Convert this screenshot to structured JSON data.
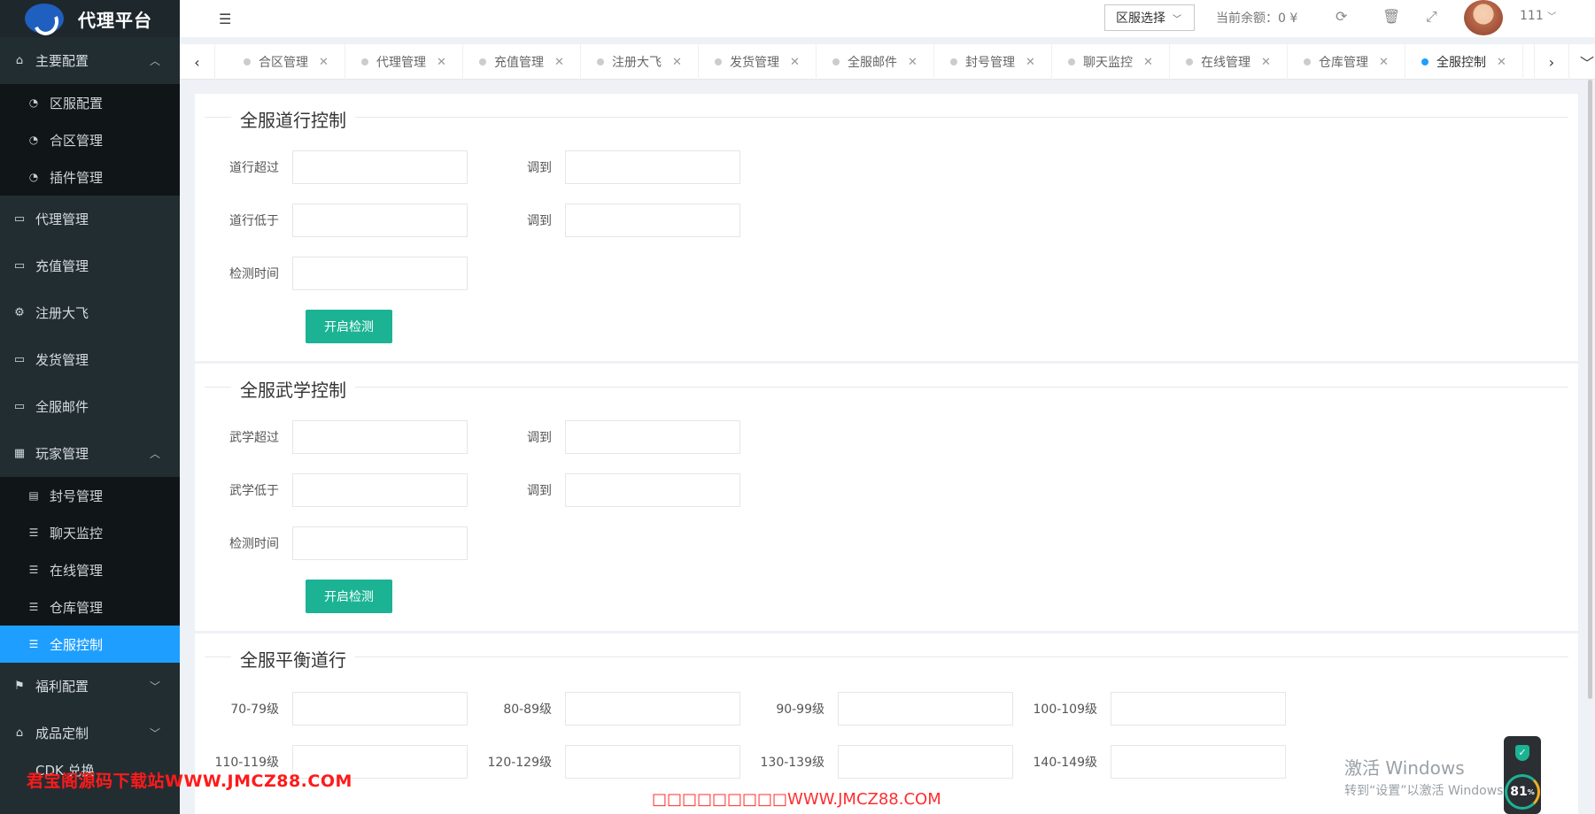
{
  "app": {
    "title": "代理平台"
  },
  "sidebar": {
    "groups": [
      {
        "label": "主要配置",
        "icon": "home-icon",
        "expanded": true,
        "items": [
          {
            "label": "区服配置",
            "icon": "dashboard-icon"
          },
          {
            "label": "合区管理",
            "icon": "dashboard-icon"
          },
          {
            "label": "插件管理",
            "icon": "dashboard-icon"
          }
        ]
      },
      {
        "label": "代理管理",
        "icon": "window-icon"
      },
      {
        "label": "充值管理",
        "icon": "window-icon"
      },
      {
        "label": "注册大飞",
        "icon": "gears-icon"
      },
      {
        "label": "发货管理",
        "icon": "window-icon"
      },
      {
        "label": "全服邮件",
        "icon": "window-icon"
      },
      {
        "label": "玩家管理",
        "icon": "calendar-icon",
        "expanded": true,
        "items": [
          {
            "label": "封号管理",
            "icon": "list-alt-icon"
          },
          {
            "label": "聊天监控",
            "icon": "list-icon"
          },
          {
            "label": "在线管理",
            "icon": "list-icon"
          },
          {
            "label": "仓库管理",
            "icon": "list-icon"
          },
          {
            "label": "全服控制",
            "icon": "list-icon",
            "active": true
          }
        ]
      },
      {
        "label": "福利配置",
        "icon": "flag-icon",
        "expanded": false
      },
      {
        "label": "成品定制",
        "icon": "home-icon",
        "expanded": false
      },
      {
        "label": "CDK 兑换"
      }
    ]
  },
  "topbar": {
    "region_select": "区服选择",
    "balance": "当前余额：0 ¥",
    "username": "111"
  },
  "tabs": [
    "合区管理",
    "代理管理",
    "充值管理",
    "注册大飞",
    "发货管理",
    "全服邮件",
    "封号管理",
    "聊天监控",
    "在线管理",
    "仓库管理",
    "全服控制"
  ],
  "active_tab": "全服控制",
  "sections": {
    "daoxing": {
      "title": "全服道行控制",
      "over_label": "道行超过",
      "low_label": "道行低于",
      "to_label": "调到",
      "time_label": "检测时间",
      "button": "开启检测"
    },
    "wuxue": {
      "title": "全服武学控制",
      "over_label": "武学超过",
      "low_label": "武学低于",
      "to_label": "调到",
      "time_label": "检测时间",
      "button": "开启检测"
    },
    "balance": {
      "title": "全服平衡道行",
      "levels": [
        "70-79级",
        "80-89级",
        "90-99级",
        "100-109级",
        "110-119级",
        "120-129级",
        "130-139级",
        "140-149级"
      ]
    }
  },
  "watermark": {
    "left": "君宝阁源码下载站WWW.JMCZ88.COM",
    "center": "□□□□□□□□□WWW.JMCZ88.COM"
  },
  "windows_activation": {
    "line1": "激活 Windows",
    "line2": "转到“设置”以激活 Windows"
  },
  "gauge": {
    "value": "81",
    "unit": "%"
  }
}
